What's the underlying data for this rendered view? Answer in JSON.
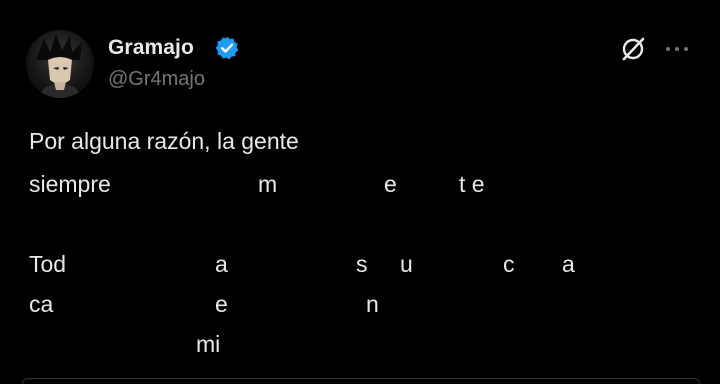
{
  "author": {
    "name": "Gramajo",
    "handle": "@Gr4majo",
    "verified": true,
    "avatar_icon": "avatar-anime-character"
  },
  "actions": {
    "grok_icon": "grok-icon",
    "more_icon": "more-options-icon"
  },
  "tweet": {
    "line1": "Por alguna razón, la gente",
    "line2": [
      "siempre",
      "m",
      "e",
      "t e"
    ],
    "line3": [
      "Tod",
      "a",
      "s",
      "u",
      "c",
      "a"
    ],
    "line4": [
      "ca",
      "e",
      "n"
    ],
    "line5": [
      "mi"
    ]
  },
  "colors": {
    "background": "#000000",
    "text": "#e7e9ea",
    "secondary": "#71767b",
    "verified": "#1d9bf0"
  }
}
